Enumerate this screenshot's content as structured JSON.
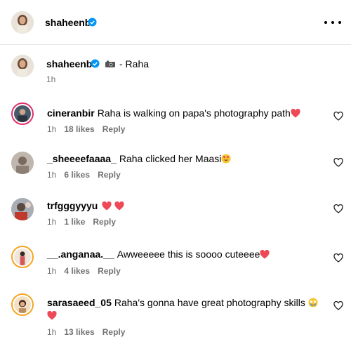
{
  "header": {
    "username": "shaheenb",
    "more_icon": "more-horizontal-icon"
  },
  "caption": {
    "username": "shaheenb",
    "text": "- Raha",
    "time": "1h"
  },
  "comments": [
    {
      "username": "cineranbir",
      "text": "Raha is walking on papa's photography path",
      "time": "1h",
      "likes": "18 likes",
      "reply": "Reply"
    },
    {
      "username": "_sheeeefaaaa_",
      "text": "Raha clicked her Maasi",
      "time": "1h",
      "likes": "6 likes",
      "reply": "Reply"
    },
    {
      "username": "trfgggyyyu",
      "text": "",
      "time": "1h",
      "likes": "1 like",
      "reply": "Reply"
    },
    {
      "username": "__.anganaa.__",
      "text": "Awweeeee this is soooo cuteeee",
      "time": "1h",
      "likes": "4 likes",
      "reply": "Reply"
    },
    {
      "username": "sarasaeed_05",
      "text": "Raha's gonna have great photography skills",
      "time": "1h",
      "likes": "13 likes",
      "reply": "Reply"
    }
  ],
  "colors": {
    "heart": "#ed4956",
    "verified": "#0095f6",
    "meta": "#737373",
    "divider": "#e6e6e6"
  }
}
